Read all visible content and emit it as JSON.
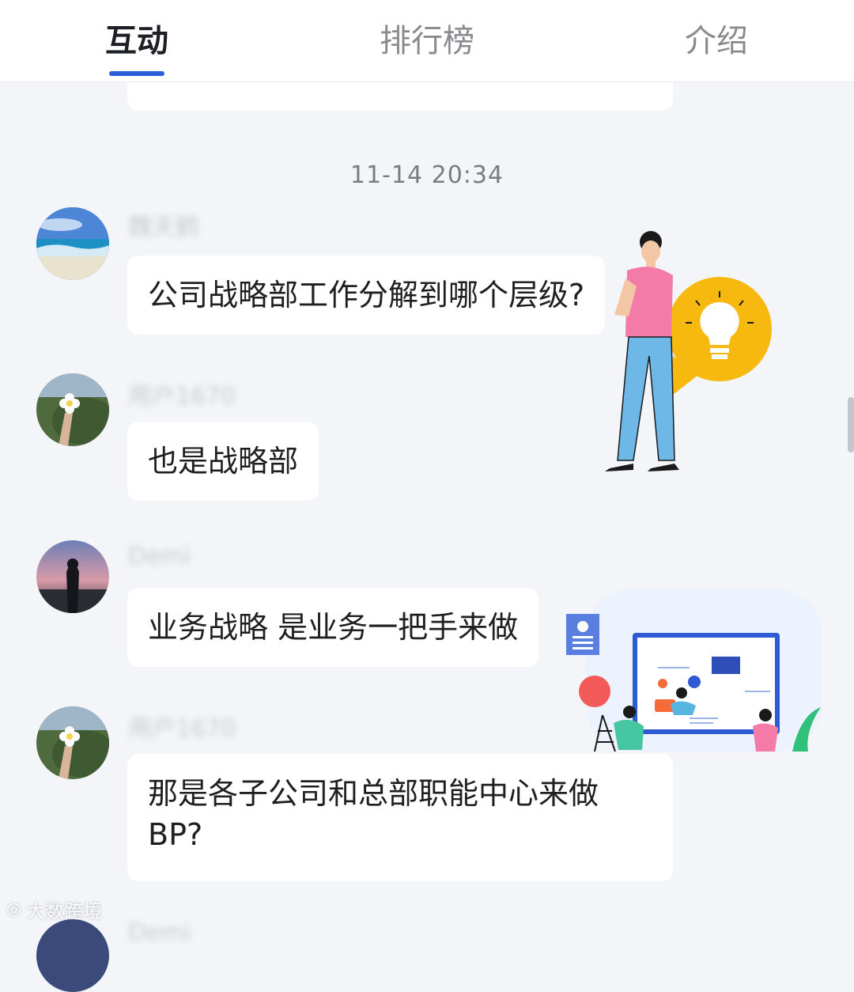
{
  "tabs": [
    {
      "label": "互动",
      "active": true
    },
    {
      "label": "排行榜",
      "active": false
    },
    {
      "label": "介绍",
      "active": false
    }
  ],
  "timestamp": "11-14 20:34",
  "messages": [
    {
      "username": "魏天鹤",
      "text": "公司战略部工作分解到哪个层级?",
      "avatar": "ocean-avatar"
    },
    {
      "username": "用户1670",
      "text": "也是战略部",
      "avatar": "flower-avatar"
    },
    {
      "username": "Demi",
      "text": "业务战略 是业务一把手来做",
      "avatar": "silhouette-avatar"
    },
    {
      "username": "用户1670",
      "text": "那是各子公司和总部职能中心来做BP?",
      "avatar": "flower-avatar"
    }
  ],
  "next_username": "Demi",
  "watermark": "大数跨境",
  "colors": {
    "accent": "#2b5fd9",
    "background": "#f4f5f9",
    "bubble": "#ffffff"
  }
}
